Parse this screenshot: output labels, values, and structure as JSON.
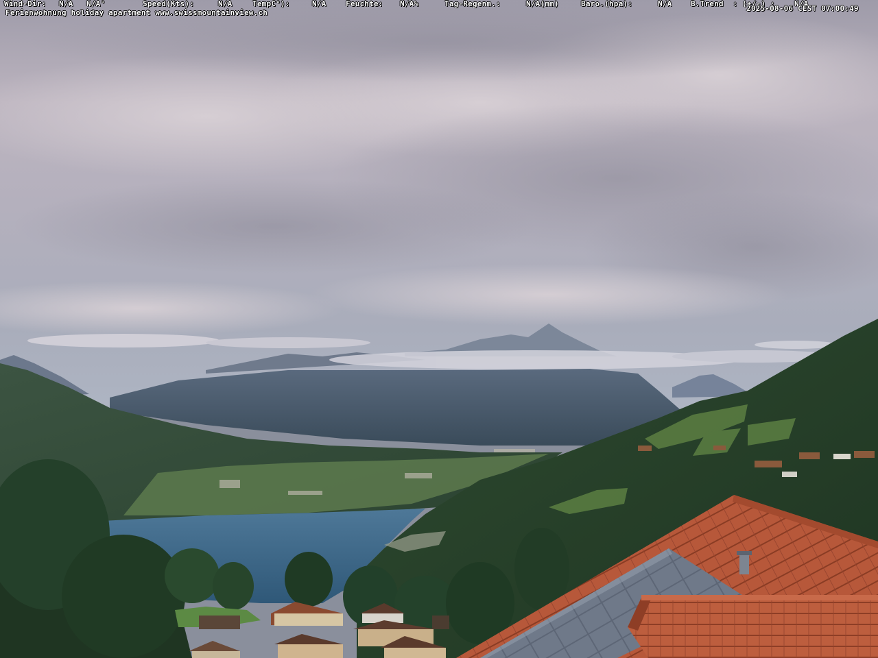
{
  "overlay": {
    "wind_label": "Wind-Dir:",
    "wind_value": "N/A",
    "wind_deg": "N/A°",
    "speed_label": "Speed(Kts):",
    "speed_value": "N/A",
    "temp_label": "TempC°):",
    "temp_value": "N/A",
    "humidity_label": "Feuchte:",
    "humidity_value": "N/A%",
    "rain_label": "Tag-Regenm.:",
    "rain_value": "N/A(mm)",
    "baro_label": "Baro.(hpa):",
    "baro_value": "N/A",
    "trend_label": "B.Trend  : (+/-) :",
    "trend_value": "N/A",
    "caption": "Ferienwohnung holiday apartment www.swissmountainview.ch",
    "timestamp": "2025-08-06 CEST 07:00:49"
  },
  "colors": {
    "sky_top": "#a8a6b2",
    "sky_mid": "#c9c3cc",
    "lake": "#3f6a8c",
    "roof": "#b9583a",
    "forest": "#25402a"
  }
}
